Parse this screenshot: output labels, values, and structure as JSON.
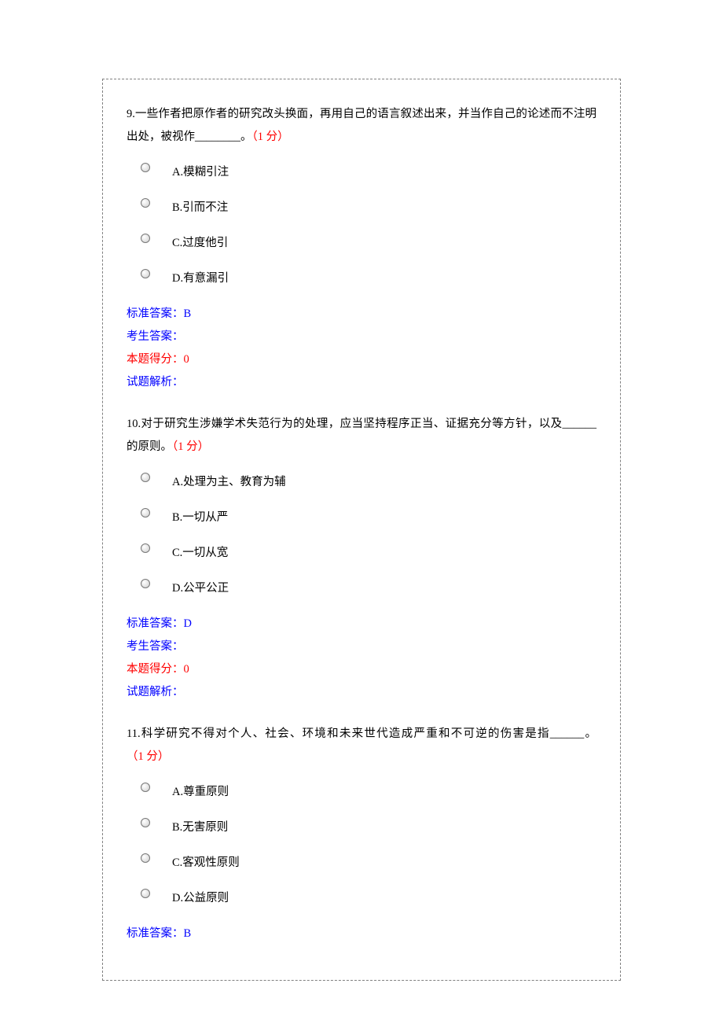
{
  "questions": [
    {
      "number": "9.",
      "text": "一些作者把原作者的研究改头换面，再用自己的语言叙述出来，并当作自己的论述而不注明出处，被视作________。",
      "points": "（1 分）",
      "options": {
        "a": "A.模糊引注",
        "b": "B.引而不注",
        "c": "C.过度他引",
        "d": "D.有意漏引"
      },
      "correct_label": "标准答案：B",
      "student_label": "考生答案：",
      "score_label": "本题得分：0",
      "analysis_label": "试题解析："
    },
    {
      "number": "10.",
      "text": "对于研究生涉嫌学术失范行为的处理，应当坚持程序正当、证据充分等方针，以及______的原则。",
      "points": "（1 分）",
      "options": {
        "a": "A.处理为主、教育为辅",
        "b": "B.一切从严",
        "c": "C.一切从宽",
        "d": "D.公平公正"
      },
      "correct_label": "标准答案：D",
      "student_label": "考生答案：",
      "score_label": "本题得分：0",
      "analysis_label": "试题解析："
    },
    {
      "number": "11.",
      "text": "科学研究不得对个人、社会、环境和未来世代造成严重和不可逆的伤害是指______。",
      "points": "（1 分）",
      "options": {
        "a": "A.尊重原则",
        "b": "B.无害原则",
        "c": "C.客观性原则",
        "d": "D.公益原则"
      },
      "correct_label": "标准答案：B"
    }
  ]
}
